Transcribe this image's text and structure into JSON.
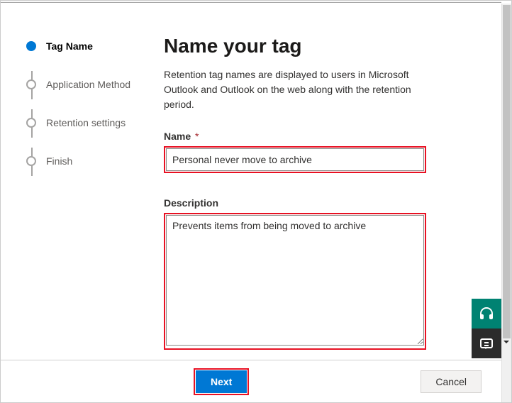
{
  "steps": [
    {
      "label": "Tag Name",
      "active": true
    },
    {
      "label": "Application Method",
      "active": false
    },
    {
      "label": "Retention settings",
      "active": false
    },
    {
      "label": "Finish",
      "active": false
    }
  ],
  "main": {
    "title": "Name your tag",
    "intro": "Retention tag names are displayed to users in Microsoft Outlook and Outlook on the web along with the retention period.",
    "name_label": "Name",
    "required_mark": "*",
    "name_value": "Personal never move to archive",
    "description_label": "Description",
    "description_value": "Prevents items from being moved to archive"
  },
  "footer": {
    "next_label": "Next",
    "cancel_label": "Cancel"
  },
  "widgets": {
    "support_icon": "headset-icon",
    "feedback_icon": "chat-icon"
  }
}
